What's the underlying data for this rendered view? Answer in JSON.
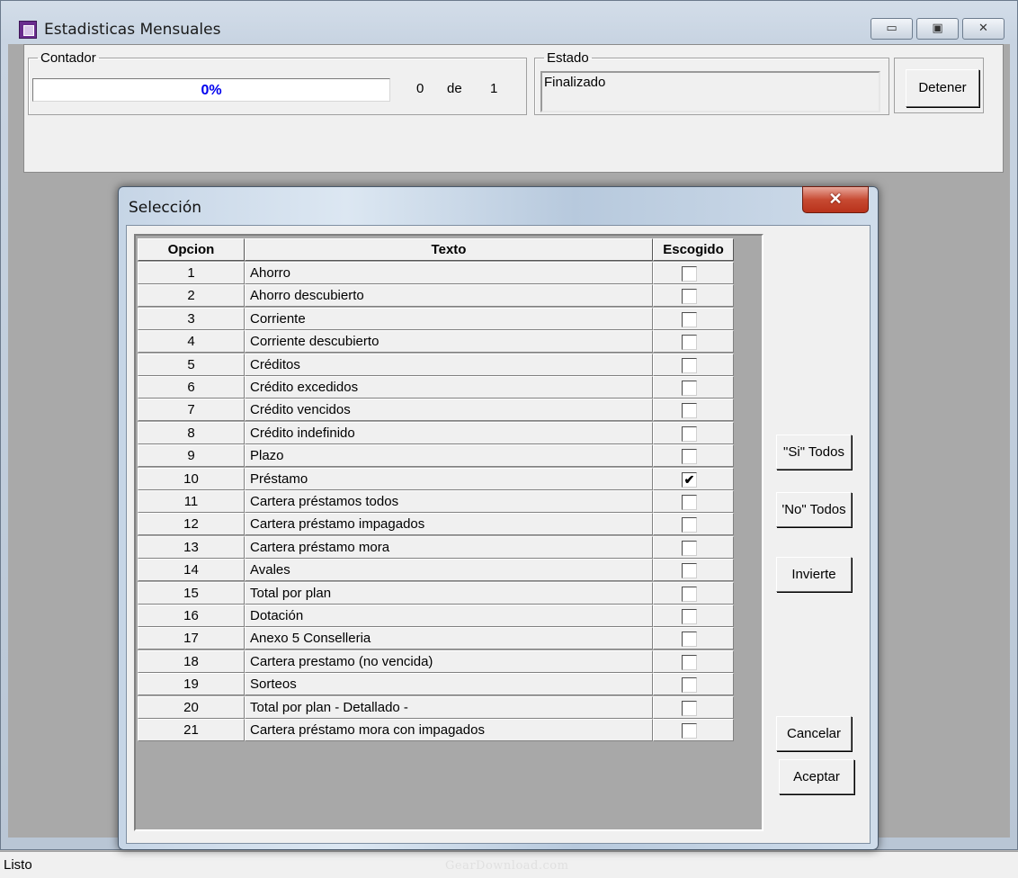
{
  "main_window": {
    "title": "Estadisticas Mensuales",
    "caption_buttons": {
      "minimize": "▭",
      "maximize": "▣",
      "close": "✕"
    },
    "contador": {
      "legend": "Contador",
      "progress_text": "0%",
      "progress_fraction": 0,
      "current": "0",
      "of_label": "de",
      "total": "1"
    },
    "estado": {
      "legend": "Estado",
      "text": "Finalizado"
    },
    "detener_label": "Detener"
  },
  "status_bar": {
    "text": "Listo",
    "watermark": "GearDownload.com"
  },
  "dialog": {
    "title": "Selección",
    "close_glyph": "✕",
    "columns": [
      "Opcion",
      "Texto",
      "Escogido"
    ],
    "rows": [
      {
        "n": "1",
        "text": "Ahorro",
        "checked": false
      },
      {
        "n": "2",
        "text": "Ahorro descubierto",
        "checked": false
      },
      {
        "n": "3",
        "text": "Corriente",
        "checked": false
      },
      {
        "n": "4",
        "text": "Corriente descubierto",
        "checked": false
      },
      {
        "n": "5",
        "text": "Créditos",
        "checked": false
      },
      {
        "n": "6",
        "text": "Crédito excedidos",
        "checked": false
      },
      {
        "n": "7",
        "text": "Crédito vencidos",
        "checked": false
      },
      {
        "n": "8",
        "text": "Crédito indefinido",
        "checked": false
      },
      {
        "n": "9",
        "text": "Plazo",
        "checked": false
      },
      {
        "n": "10",
        "text": "Préstamo",
        "checked": true
      },
      {
        "n": "11",
        "text": "Cartera préstamos todos",
        "checked": false
      },
      {
        "n": "12",
        "text": "Cartera préstamo impagados",
        "checked": false
      },
      {
        "n": "13",
        "text": "Cartera préstamo mora",
        "checked": false
      },
      {
        "n": "14",
        "text": "Avales",
        "checked": false
      },
      {
        "n": "15",
        "text": "Total por plan",
        "checked": false
      },
      {
        "n": "16",
        "text": "Dotación",
        "checked": false
      },
      {
        "n": "17",
        "text": "Anexo 5 Conselleria",
        "checked": false
      },
      {
        "n": "18",
        "text": "Cartera prestamo (no vencida)",
        "checked": false
      },
      {
        "n": "19",
        "text": "Sorteos",
        "checked": false
      },
      {
        "n": "20",
        "text": "Total por plan - Detallado -",
        "checked": false
      },
      {
        "n": "21",
        "text": "Cartera préstamo mora con impagados",
        "checked": false
      }
    ],
    "check_glyph": "✔",
    "buttons": {
      "si_todos": "\"Si\" Todos",
      "no_todos": "'No\" Todos",
      "invierte": "Invierte",
      "cancelar": "Cancelar",
      "aceptar": "Aceptar"
    }
  }
}
